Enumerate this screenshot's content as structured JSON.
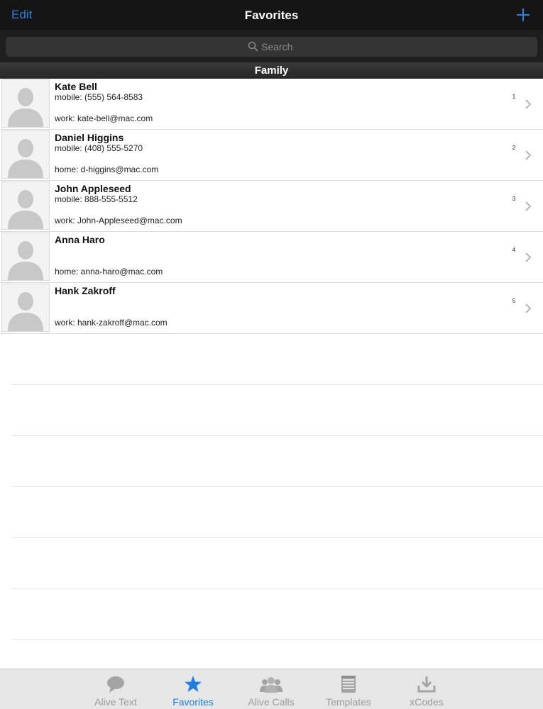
{
  "navbar": {
    "edit_label": "Edit",
    "title": "Favorites",
    "add_icon": "plus-icon"
  },
  "search": {
    "placeholder": "Search",
    "icon": "search-icon"
  },
  "section": {
    "title": "Family"
  },
  "contacts": [
    {
      "name": "Kate Bell",
      "phone": "mobile: (555) 564-8583",
      "email": "work: kate-bell@mac.com",
      "rank": "1"
    },
    {
      "name": "Daniel Higgins",
      "phone": "mobile: (408) 555-5270",
      "email": "home: d-higgins@mac.com",
      "rank": "2"
    },
    {
      "name": "John Appleseed",
      "phone": "mobile: 888-555-5512",
      "email": "work: John-Appleseed@mac.com",
      "rank": "3"
    },
    {
      "name": "Anna Haro",
      "phone": "",
      "email": "home: anna-haro@mac.com",
      "rank": "4"
    },
    {
      "name": "Hank Zakroff",
      "phone": "",
      "email": "work: hank-zakroff@mac.com",
      "rank": "5"
    }
  ],
  "tabs": [
    {
      "label": "Alive Text",
      "icon": "speech-bubble-icon",
      "active": false
    },
    {
      "label": "Favorites",
      "icon": "star-icon",
      "active": true
    },
    {
      "label": "Alive Calls",
      "icon": "group-icon",
      "active": false
    },
    {
      "label": "Templates",
      "icon": "notepad-icon",
      "active": false
    },
    {
      "label": "xCodes",
      "icon": "download-icon",
      "active": false
    }
  ],
  "colors": {
    "accent": "#1d7fe2",
    "navbar_bg": "#151515",
    "inactive_tab": "#9a9a9a"
  }
}
